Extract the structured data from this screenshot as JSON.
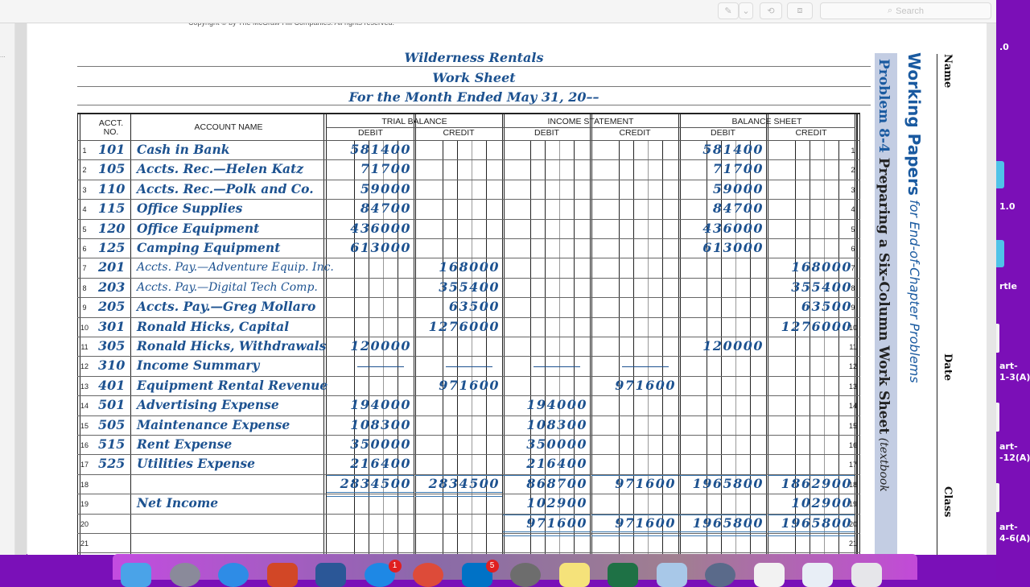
{
  "app": {
    "toolbar": {
      "markup_icon": "pen-icon",
      "chevron_icon": "chevron-down-icon",
      "rotate_icon": "rotate-icon",
      "toolbox_icon": "toolbox-icon",
      "search_placeholder": "Search"
    },
    "sidebar_text": "..."
  },
  "document": {
    "copyright": "Copyright © by The McGraw-Hill Companies. All rights reserved.",
    "company": "Wilderness Rentals",
    "title": "Work Sheet",
    "period": "For the Month Ended May 31, 20––",
    "side": {
      "working_papers": "Working Papers",
      "working_papers_sub": " for End-of-Chapter Problems",
      "problem": "Problem 8-4",
      "problem_title": "  Preparing a Six-Column Work Sheet",
      "problem_note": " (textbook",
      "name_label": "Name",
      "date_label": "Date",
      "class_label": "Class"
    },
    "headers": {
      "acct_no": "ACCT. NO.",
      "account_name": "ACCOUNT NAME",
      "trial_balance": "TRIAL BALANCE",
      "income_statement": "INCOME STATEMENT",
      "balance_sheet": "BALANCE SHEET",
      "debit": "DEBIT",
      "credit": "CREDIT"
    },
    "rows": [
      {
        "n": "1",
        "acct": "101",
        "name": "Cash in Bank",
        "tb_dr": "581400",
        "tb_cr": "",
        "is_dr": "",
        "is_cr": "",
        "bs_dr": "581400",
        "bs_cr": ""
      },
      {
        "n": "2",
        "acct": "105",
        "name": "Accts. Rec.—Helen Katz",
        "tb_dr": "71700",
        "tb_cr": "",
        "is_dr": "",
        "is_cr": "",
        "bs_dr": "71700",
        "bs_cr": ""
      },
      {
        "n": "3",
        "acct": "110",
        "name": "Accts. Rec.—Polk and Co.",
        "tb_dr": "59000",
        "tb_cr": "",
        "is_dr": "",
        "is_cr": "",
        "bs_dr": "59000",
        "bs_cr": ""
      },
      {
        "n": "4",
        "acct": "115",
        "name": "Office Supplies",
        "tb_dr": "84700",
        "tb_cr": "",
        "is_dr": "",
        "is_cr": "",
        "bs_dr": "84700",
        "bs_cr": ""
      },
      {
        "n": "5",
        "acct": "120",
        "name": "Office Equipment",
        "tb_dr": "436000",
        "tb_cr": "",
        "is_dr": "",
        "is_cr": "",
        "bs_dr": "436000",
        "bs_cr": ""
      },
      {
        "n": "6",
        "acct": "125",
        "name": "Camping Equipment",
        "tb_dr": "613000",
        "tb_cr": "",
        "is_dr": "",
        "is_cr": "",
        "bs_dr": "613000",
        "bs_cr": ""
      },
      {
        "n": "7",
        "acct": "201",
        "name": "Accts. Pay.—Adventure Equip. Inc.",
        "tb_dr": "",
        "tb_cr": "168000",
        "is_dr": "",
        "is_cr": "",
        "bs_dr": "",
        "bs_cr": "168000",
        "small": true
      },
      {
        "n": "8",
        "acct": "203",
        "name": "Accts. Pay.—Digital Tech Comp.",
        "tb_dr": "",
        "tb_cr": "355400",
        "is_dr": "",
        "is_cr": "",
        "bs_dr": "",
        "bs_cr": "355400",
        "small": true
      },
      {
        "n": "9",
        "acct": "205",
        "name": "Accts. Pay.—Greg Mollaro",
        "tb_dr": "",
        "tb_cr": "63500",
        "is_dr": "",
        "is_cr": "",
        "bs_dr": "",
        "bs_cr": "63500"
      },
      {
        "n": "10",
        "acct": "301",
        "name": "Ronald Hicks, Capital",
        "tb_dr": "",
        "tb_cr": "1276000",
        "is_dr": "",
        "is_cr": "",
        "bs_dr": "",
        "bs_cr": "1276000"
      },
      {
        "n": "11",
        "acct": "305",
        "name": "Ronald Hicks, Withdrawals",
        "tb_dr": "120000",
        "tb_cr": "",
        "is_dr": "",
        "is_cr": "",
        "bs_dr": "120000",
        "bs_cr": ""
      },
      {
        "n": "12",
        "acct": "310",
        "name": "Income Summary",
        "tb_dr": "—",
        "tb_cr": "—",
        "is_dr": "—",
        "is_cr": "—",
        "bs_dr": "",
        "bs_cr": "",
        "dashes": true
      },
      {
        "n": "13",
        "acct": "401",
        "name": "Equipment Rental Revenue",
        "tb_dr": "",
        "tb_cr": "971600",
        "is_dr": "",
        "is_cr": "971600",
        "bs_dr": "",
        "bs_cr": ""
      },
      {
        "n": "14",
        "acct": "501",
        "name": "Advertising Expense",
        "tb_dr": "194000",
        "tb_cr": "",
        "is_dr": "194000",
        "is_cr": "",
        "bs_dr": "",
        "bs_cr": ""
      },
      {
        "n": "15",
        "acct": "505",
        "name": "Maintenance Expense",
        "tb_dr": "108300",
        "tb_cr": "",
        "is_dr": "108300",
        "is_cr": "",
        "bs_dr": "",
        "bs_cr": ""
      },
      {
        "n": "16",
        "acct": "515",
        "name": "Rent Expense",
        "tb_dr": "350000",
        "tb_cr": "",
        "is_dr": "350000",
        "is_cr": "",
        "bs_dr": "",
        "bs_cr": ""
      },
      {
        "n": "17",
        "acct": "525",
        "name": "Utilities Expense",
        "tb_dr": "216400",
        "tb_cr": "",
        "is_dr": "216400",
        "is_cr": "",
        "bs_dr": "",
        "bs_cr": ""
      },
      {
        "n": "18",
        "acct": "",
        "name": "",
        "tb_dr": "2834500",
        "tb_cr": "2834500",
        "is_dr": "868700",
        "is_cr": "971600",
        "bs_dr": "1965800",
        "bs_cr": "1862900"
      },
      {
        "n": "19",
        "acct": "",
        "name": "Net Income",
        "tb_dr": "",
        "tb_cr": "",
        "is_dr": "102900",
        "is_cr": "",
        "bs_dr": "",
        "bs_cr": "102900"
      },
      {
        "n": "20",
        "acct": "",
        "name": "",
        "tb_dr": "",
        "tb_cr": "",
        "is_dr": "971600",
        "is_cr": "971600",
        "bs_dr": "1965800",
        "bs_cr": "1965800"
      },
      {
        "n": "21",
        "acct": "",
        "name": "",
        "tb_dr": "",
        "tb_cr": "",
        "is_dr": "",
        "is_cr": "",
        "bs_dr": "",
        "bs_cr": ""
      }
    ]
  },
  "desktop": {
    "labels": [
      ".0",
      "1.0",
      "rtle",
      "art-\n1-3(A)",
      "art-\n-12(A)",
      "art-\n4-6(A)"
    ]
  },
  "dock": {
    "apps": [
      {
        "name": "finder",
        "color": "#4aa3e8"
      },
      {
        "name": "launchpad",
        "color": "#8a8a9a"
      },
      {
        "name": "safari",
        "color": "#2e8ce6"
      },
      {
        "name": "powerpoint",
        "color": "#d24726"
      },
      {
        "name": "word",
        "color": "#2b5797"
      },
      {
        "name": "app-store",
        "color": "#1e88e5",
        "badge": "1"
      },
      {
        "name": "chrome",
        "color": "#dd4b39"
      },
      {
        "name": "outlook",
        "color": "#0072c6",
        "badge": "5"
      },
      {
        "name": "system-preferences",
        "color": "#6d6d6d"
      },
      {
        "name": "stickies",
        "color": "#f5e27a"
      },
      {
        "name": "excel",
        "color": "#1e7145"
      },
      {
        "name": "preview",
        "color": "#a8c8e8"
      },
      {
        "name": "quicktime",
        "color": "#5a6a8a"
      },
      {
        "name": "document",
        "color": "#f2f2f2"
      },
      {
        "name": "screenshot",
        "color": "#e8eef6"
      },
      {
        "name": "trash",
        "color": "#e6e6ea"
      }
    ]
  }
}
